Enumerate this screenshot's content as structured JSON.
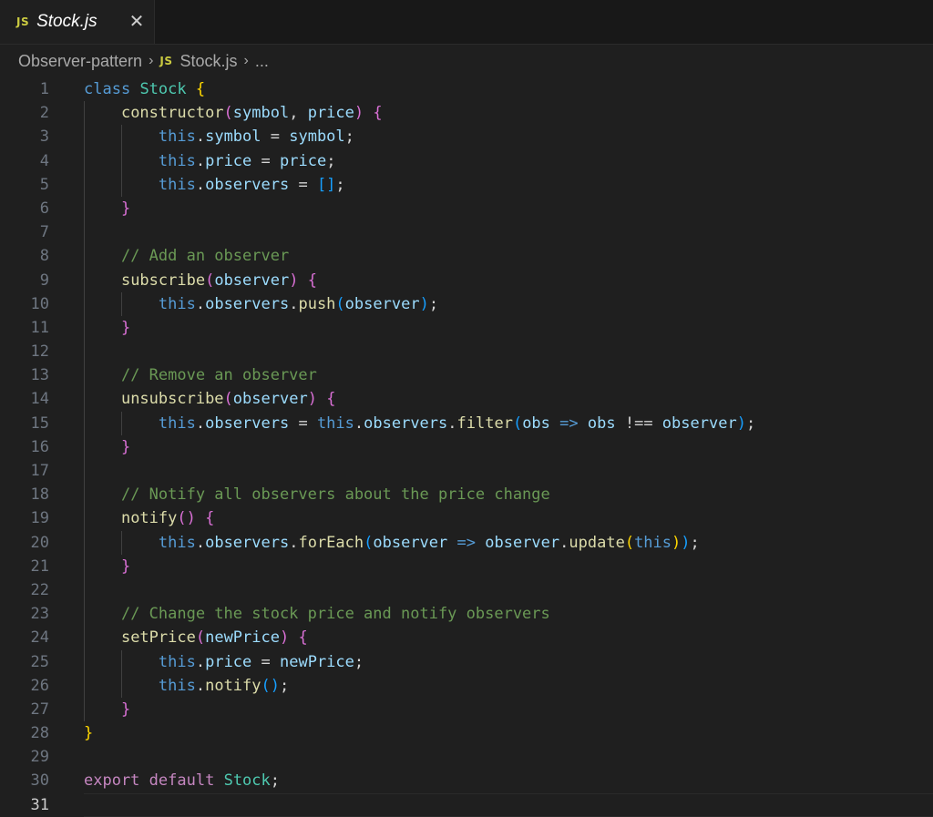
{
  "tab": {
    "icon_label": "JS",
    "title": "Stock.js",
    "close_glyph": "✕"
  },
  "breadcrumb": {
    "folder": "Observer-pattern",
    "file_icon_label": "JS",
    "file": "Stock.js",
    "trailing": "..."
  },
  "editor": {
    "active_line": 31,
    "lines": [
      {
        "n": "1",
        "tokens": [
          [
            "kw",
            "class"
          ],
          [
            "plain",
            " "
          ],
          [
            "cls",
            "Stock"
          ],
          [
            "plain",
            " "
          ],
          [
            "p1",
            "{"
          ]
        ]
      },
      {
        "n": "2",
        "tokens": [
          [
            "plain",
            "    "
          ],
          [
            "fn",
            "constructor"
          ],
          [
            "p2",
            "("
          ],
          [
            "var",
            "symbol"
          ],
          [
            "plain",
            ", "
          ],
          [
            "var",
            "price"
          ],
          [
            "p2",
            ")"
          ],
          [
            "plain",
            " "
          ],
          [
            "p2",
            "{"
          ]
        ]
      },
      {
        "n": "3",
        "tokens": [
          [
            "plain",
            "        "
          ],
          [
            "kw",
            "this"
          ],
          [
            "plain",
            "."
          ],
          [
            "var",
            "symbol"
          ],
          [
            "plain",
            " = "
          ],
          [
            "var",
            "symbol"
          ],
          [
            "plain",
            ";"
          ]
        ]
      },
      {
        "n": "4",
        "tokens": [
          [
            "plain",
            "        "
          ],
          [
            "kw",
            "this"
          ],
          [
            "plain",
            "."
          ],
          [
            "var",
            "price"
          ],
          [
            "plain",
            " = "
          ],
          [
            "var",
            "price"
          ],
          [
            "plain",
            ";"
          ]
        ]
      },
      {
        "n": "5",
        "tokens": [
          [
            "plain",
            "        "
          ],
          [
            "kw",
            "this"
          ],
          [
            "plain",
            "."
          ],
          [
            "var",
            "observers"
          ],
          [
            "plain",
            " = "
          ],
          [
            "p3",
            "[]"
          ],
          [
            "plain",
            ";"
          ]
        ]
      },
      {
        "n": "6",
        "tokens": [
          [
            "plain",
            "    "
          ],
          [
            "p2",
            "}"
          ]
        ]
      },
      {
        "n": "7",
        "tokens": []
      },
      {
        "n": "8",
        "tokens": [
          [
            "plain",
            "    "
          ],
          [
            "cmt",
            "// Add an observer"
          ]
        ]
      },
      {
        "n": "9",
        "tokens": [
          [
            "plain",
            "    "
          ],
          [
            "fn",
            "subscribe"
          ],
          [
            "p2",
            "("
          ],
          [
            "var",
            "observer"
          ],
          [
            "p2",
            ")"
          ],
          [
            "plain",
            " "
          ],
          [
            "p2",
            "{"
          ]
        ]
      },
      {
        "n": "10",
        "tokens": [
          [
            "plain",
            "        "
          ],
          [
            "kw",
            "this"
          ],
          [
            "plain",
            "."
          ],
          [
            "var",
            "observers"
          ],
          [
            "plain",
            "."
          ],
          [
            "fn",
            "push"
          ],
          [
            "p3",
            "("
          ],
          [
            "var",
            "observer"
          ],
          [
            "p3",
            ")"
          ],
          [
            "plain",
            ";"
          ]
        ]
      },
      {
        "n": "11",
        "tokens": [
          [
            "plain",
            "    "
          ],
          [
            "p2",
            "}"
          ]
        ]
      },
      {
        "n": "12",
        "tokens": []
      },
      {
        "n": "13",
        "tokens": [
          [
            "plain",
            "    "
          ],
          [
            "cmt",
            "// Remove an observer"
          ]
        ]
      },
      {
        "n": "14",
        "tokens": [
          [
            "plain",
            "    "
          ],
          [
            "fn",
            "unsubscribe"
          ],
          [
            "p2",
            "("
          ],
          [
            "var",
            "observer"
          ],
          [
            "p2",
            ")"
          ],
          [
            "plain",
            " "
          ],
          [
            "p2",
            "{"
          ]
        ]
      },
      {
        "n": "15",
        "tokens": [
          [
            "plain",
            "        "
          ],
          [
            "kw",
            "this"
          ],
          [
            "plain",
            "."
          ],
          [
            "var",
            "observers"
          ],
          [
            "plain",
            " = "
          ],
          [
            "kw",
            "this"
          ],
          [
            "plain",
            "."
          ],
          [
            "var",
            "observers"
          ],
          [
            "plain",
            "."
          ],
          [
            "fn",
            "filter"
          ],
          [
            "p3",
            "("
          ],
          [
            "var",
            "obs"
          ],
          [
            "plain",
            " "
          ],
          [
            "kw",
            "=>"
          ],
          [
            "plain",
            " "
          ],
          [
            "var",
            "obs"
          ],
          [
            "plain",
            " !== "
          ],
          [
            "var",
            "observer"
          ],
          [
            "p3",
            ")"
          ],
          [
            "plain",
            ";"
          ]
        ]
      },
      {
        "n": "16",
        "tokens": [
          [
            "plain",
            "    "
          ],
          [
            "p2",
            "}"
          ]
        ]
      },
      {
        "n": "17",
        "tokens": []
      },
      {
        "n": "18",
        "tokens": [
          [
            "plain",
            "    "
          ],
          [
            "cmt",
            "// Notify all observers about the price change"
          ]
        ]
      },
      {
        "n": "19",
        "tokens": [
          [
            "plain",
            "    "
          ],
          [
            "fn",
            "notify"
          ],
          [
            "p2",
            "()"
          ],
          [
            "plain",
            " "
          ],
          [
            "p2",
            "{"
          ]
        ]
      },
      {
        "n": "20",
        "tokens": [
          [
            "plain",
            "        "
          ],
          [
            "kw",
            "this"
          ],
          [
            "plain",
            "."
          ],
          [
            "var",
            "observers"
          ],
          [
            "plain",
            "."
          ],
          [
            "fn",
            "forEach"
          ],
          [
            "p3",
            "("
          ],
          [
            "var",
            "observer"
          ],
          [
            "plain",
            " "
          ],
          [
            "kw",
            "=>"
          ],
          [
            "plain",
            " "
          ],
          [
            "var",
            "observer"
          ],
          [
            "plain",
            "."
          ],
          [
            "fn",
            "update"
          ],
          [
            "p1",
            "("
          ],
          [
            "kw",
            "this"
          ],
          [
            "p1",
            ")"
          ],
          [
            "p3",
            ")"
          ],
          [
            "plain",
            ";"
          ]
        ]
      },
      {
        "n": "21",
        "tokens": [
          [
            "plain",
            "    "
          ],
          [
            "p2",
            "}"
          ]
        ]
      },
      {
        "n": "22",
        "tokens": []
      },
      {
        "n": "23",
        "tokens": [
          [
            "plain",
            "    "
          ],
          [
            "cmt",
            "// Change the stock price and notify observers"
          ]
        ]
      },
      {
        "n": "24",
        "tokens": [
          [
            "plain",
            "    "
          ],
          [
            "fn",
            "setPrice"
          ],
          [
            "p2",
            "("
          ],
          [
            "var",
            "newPrice"
          ],
          [
            "p2",
            ")"
          ],
          [
            "plain",
            " "
          ],
          [
            "p2",
            "{"
          ]
        ]
      },
      {
        "n": "25",
        "tokens": [
          [
            "plain",
            "        "
          ],
          [
            "kw",
            "this"
          ],
          [
            "plain",
            "."
          ],
          [
            "var",
            "price"
          ],
          [
            "plain",
            " = "
          ],
          [
            "var",
            "newPrice"
          ],
          [
            "plain",
            ";"
          ]
        ]
      },
      {
        "n": "26",
        "tokens": [
          [
            "plain",
            "        "
          ],
          [
            "kw",
            "this"
          ],
          [
            "plain",
            "."
          ],
          [
            "fn",
            "notify"
          ],
          [
            "p3",
            "()"
          ],
          [
            "plain",
            ";"
          ]
        ]
      },
      {
        "n": "27",
        "tokens": [
          [
            "plain",
            "    "
          ],
          [
            "p2",
            "}"
          ]
        ]
      },
      {
        "n": "28",
        "tokens": [
          [
            "p1",
            "}"
          ]
        ]
      },
      {
        "n": "29",
        "tokens": []
      },
      {
        "n": "30",
        "tokens": [
          [
            "kw2",
            "export"
          ],
          [
            "plain",
            " "
          ],
          [
            "kw2",
            "default"
          ],
          [
            "plain",
            " "
          ],
          [
            "cls",
            "Stock"
          ],
          [
            "plain",
            ";"
          ]
        ]
      },
      {
        "n": "31",
        "tokens": []
      }
    ]
  }
}
